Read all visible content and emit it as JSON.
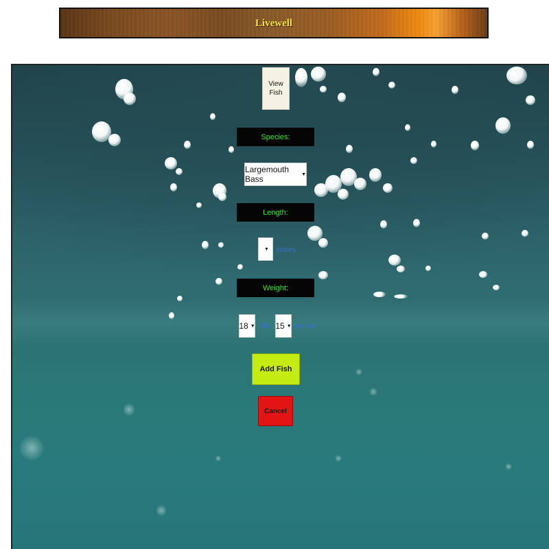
{
  "header": {
    "title": "Livewell"
  },
  "nav": {
    "view_fish_line1": "View",
    "view_fish_line2": "Fish"
  },
  "form": {
    "species_label": "Species:",
    "species_value": "Largemouth Bass",
    "length_label": "Length:",
    "length_value": "",
    "length_unit": "inches",
    "weight_label": "Weight:",
    "weight_lbs_value": "18",
    "weight_lbs_unit": "lbs",
    "weight_oz_value": "15",
    "weight_oz_unit": "ounces",
    "add_button": "Add Fish",
    "cancel_button": "Cancel"
  },
  "icons": {
    "dropdown": "caret-down-icon"
  },
  "colors": {
    "label_bg": "#050505",
    "label_text": "#41e23b",
    "unit_text": "#3b6fd6",
    "add_button": "#c5ec12",
    "cancel_button": "#e41414",
    "title_text": "#f2e23a"
  }
}
